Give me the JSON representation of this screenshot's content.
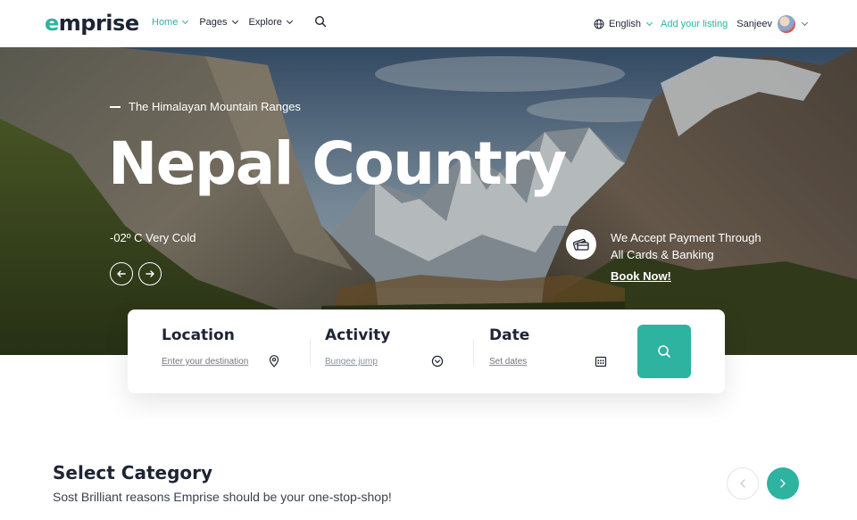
{
  "brand": {
    "logo_e": "e",
    "logo_rest": "mprise",
    "accent": "#2db3a0"
  },
  "nav": {
    "links": [
      {
        "label": "Home",
        "active": true
      },
      {
        "label": "Pages",
        "active": false
      },
      {
        "label": "Explore",
        "active": false
      }
    ],
    "search_icon": "search-icon",
    "language": "English",
    "add_listing": "Add your listing",
    "user_name": "Sanjeev"
  },
  "hero": {
    "subtitle": "The Himalayan Mountain Ranges",
    "title": "Nepal Country",
    "temperature": "-02º C Very Cold",
    "payment_line1": "We Accept Payment Through",
    "payment_line2": "All Cards & Banking",
    "cta": "Book Now!"
  },
  "search": {
    "location_label": "Location",
    "location_placeholder": "Enter your destination",
    "activity_label": "Activity",
    "activity_value": "Bungee jump",
    "date_label": "Date",
    "date_placeholder": "Set dates"
  },
  "category": {
    "title": "Select Category",
    "subtitle": "Sost Brilliant reasons Emprise should be your one-stop-shop!"
  }
}
